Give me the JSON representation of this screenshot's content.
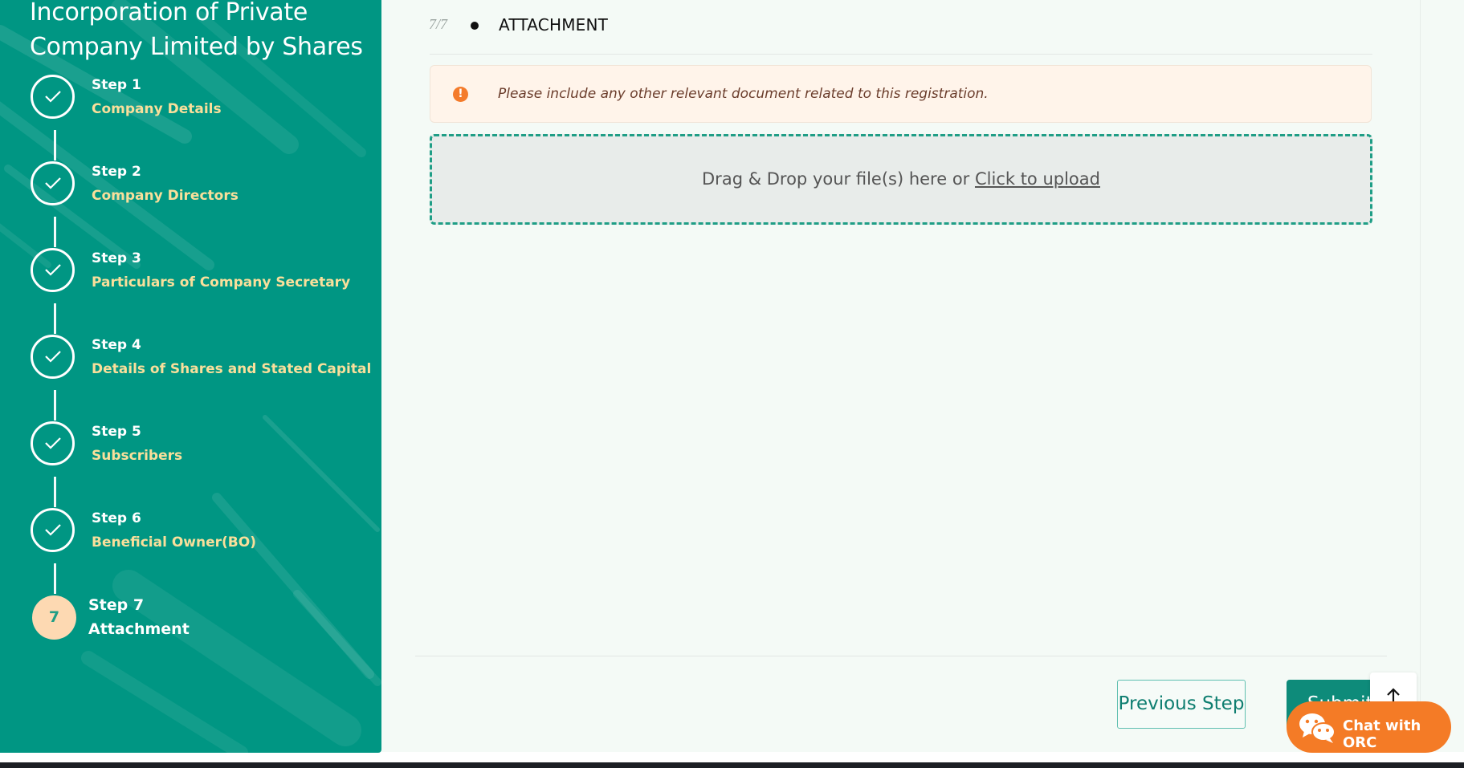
{
  "sidebar": {
    "title": "Incorporation of Private Company Limited by Shares",
    "steps": [
      {
        "label": "Step 1",
        "name": "Company Details",
        "status": "done"
      },
      {
        "label": "Step 2",
        "name": "Company Directors",
        "status": "done"
      },
      {
        "label": "Step 3",
        "name": "Particulars of Company Secretary",
        "status": "done"
      },
      {
        "label": "Step 4",
        "name": "Details of Shares and Stated Capital",
        "status": "done"
      },
      {
        "label": "Step 5",
        "name": "Subscribers",
        "status": "done"
      },
      {
        "label": "Step 6",
        "name": "Beneficial Owner(BO)",
        "status": "done"
      },
      {
        "label": "Step 7",
        "name": "Attachment",
        "status": "current",
        "number": "7"
      }
    ]
  },
  "main": {
    "step_counter": "7/7",
    "section_title": "ATTACHMENT",
    "alert_text": "Please include any other relevant document related to this registration.",
    "dropzone_text": "Drag & Drop your file(s) here or ",
    "dropzone_link": "Click to upload"
  },
  "footer": {
    "previous_label": "Previous Step",
    "submit_label": "Submit"
  },
  "chat": {
    "label": "Chat with ORC"
  },
  "colors": {
    "sidebar_bg": "#009683",
    "step_name": "#f9df9b",
    "current_step_circle": "#fdd9b2",
    "accent": "#0e8b7a",
    "chat_bg": "#f47b26",
    "alert_bg": "#fff4ea"
  },
  "icons": [
    "check-icon",
    "alert-icon",
    "arrow-up-icon",
    "wechat-icon"
  ]
}
